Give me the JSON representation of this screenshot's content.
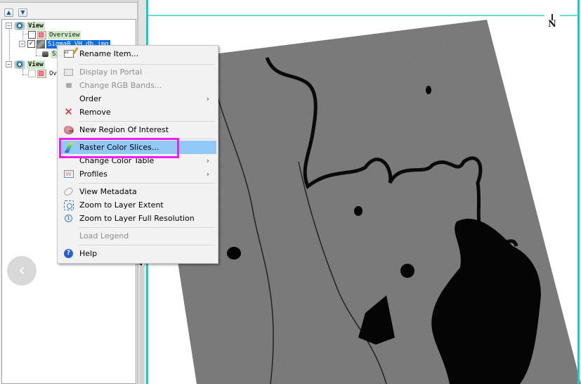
{
  "layer_panel": {
    "toolbar": {
      "move_up_icon": "arrow-up-icon",
      "move_down_icon": "arrow-down-icon"
    },
    "tree": [
      {
        "type": "view",
        "label": "View",
        "expanded": true
      },
      {
        "type": "overview",
        "label": "Overview",
        "checked": false
      },
      {
        "type": "raster",
        "label": "Sigma0_VH_db.img",
        "checked": true,
        "selected": true
      },
      {
        "type": "band",
        "label": "Si"
      },
      {
        "type": "view",
        "label": "View",
        "expanded": true
      },
      {
        "type": "overview",
        "label": "Ov",
        "checked": false
      }
    ]
  },
  "context_menu": {
    "items": [
      {
        "label": "Rename Item...",
        "icon": "rename-icon",
        "enabled": true
      },
      {
        "separator": true
      },
      {
        "label": "Display in Portal",
        "icon": "portal-icon",
        "enabled": false
      },
      {
        "label": "Change RGB Bands...",
        "icon": "rgb-bands-icon",
        "enabled": false
      },
      {
        "label": "Order",
        "icon": null,
        "enabled": true,
        "submenu": true
      },
      {
        "label": "Remove",
        "icon": "remove-icon",
        "enabled": true
      },
      {
        "separator": true
      },
      {
        "label": "New Region Of Interest",
        "icon": "roi-icon",
        "enabled": true
      },
      {
        "separator": true
      },
      {
        "label": "Raster Color Slices...",
        "icon": "color-slices-icon",
        "enabled": true,
        "highlighted": true
      },
      {
        "label": "Change Color Table",
        "icon": null,
        "enabled": true,
        "submenu": true
      },
      {
        "label": "Profiles",
        "icon": "profiles-icon",
        "enabled": true,
        "submenu": true
      },
      {
        "separator": true
      },
      {
        "label": "View Metadata",
        "icon": "metadata-icon",
        "enabled": true
      },
      {
        "label": "Zoom to Layer Extent",
        "icon": "zoom-extent-icon",
        "enabled": true
      },
      {
        "label": "Zoom to Layer Full Resolution",
        "icon": "zoom-full-resolution-icon",
        "enabled": true
      },
      {
        "separator": true
      },
      {
        "label": "Load Legend",
        "icon": null,
        "enabled": false
      },
      {
        "separator": true
      },
      {
        "label": "Help",
        "icon": "help-icon",
        "enabled": true
      }
    ],
    "submenu_arrow": "›",
    "annotation_color": "#f01ef0",
    "highlight_color": "#90c8f6"
  },
  "display": {
    "north_arrow_label": "N",
    "frame_color": "#1ec9c9",
    "image_description": "SAR grayscale image (Sigma0 VH dB) showing rivers and flooded water bodies"
  },
  "nav": {
    "back_button_glyph": "‹"
  },
  "glyphs": {
    "expander": "−",
    "check": "✓",
    "up": "▲",
    "down": "▼",
    "help": "?",
    "remove": "✕",
    "roi_text": "roi",
    "rename_text": "ab",
    "profile_text": "\\/\\/"
  }
}
